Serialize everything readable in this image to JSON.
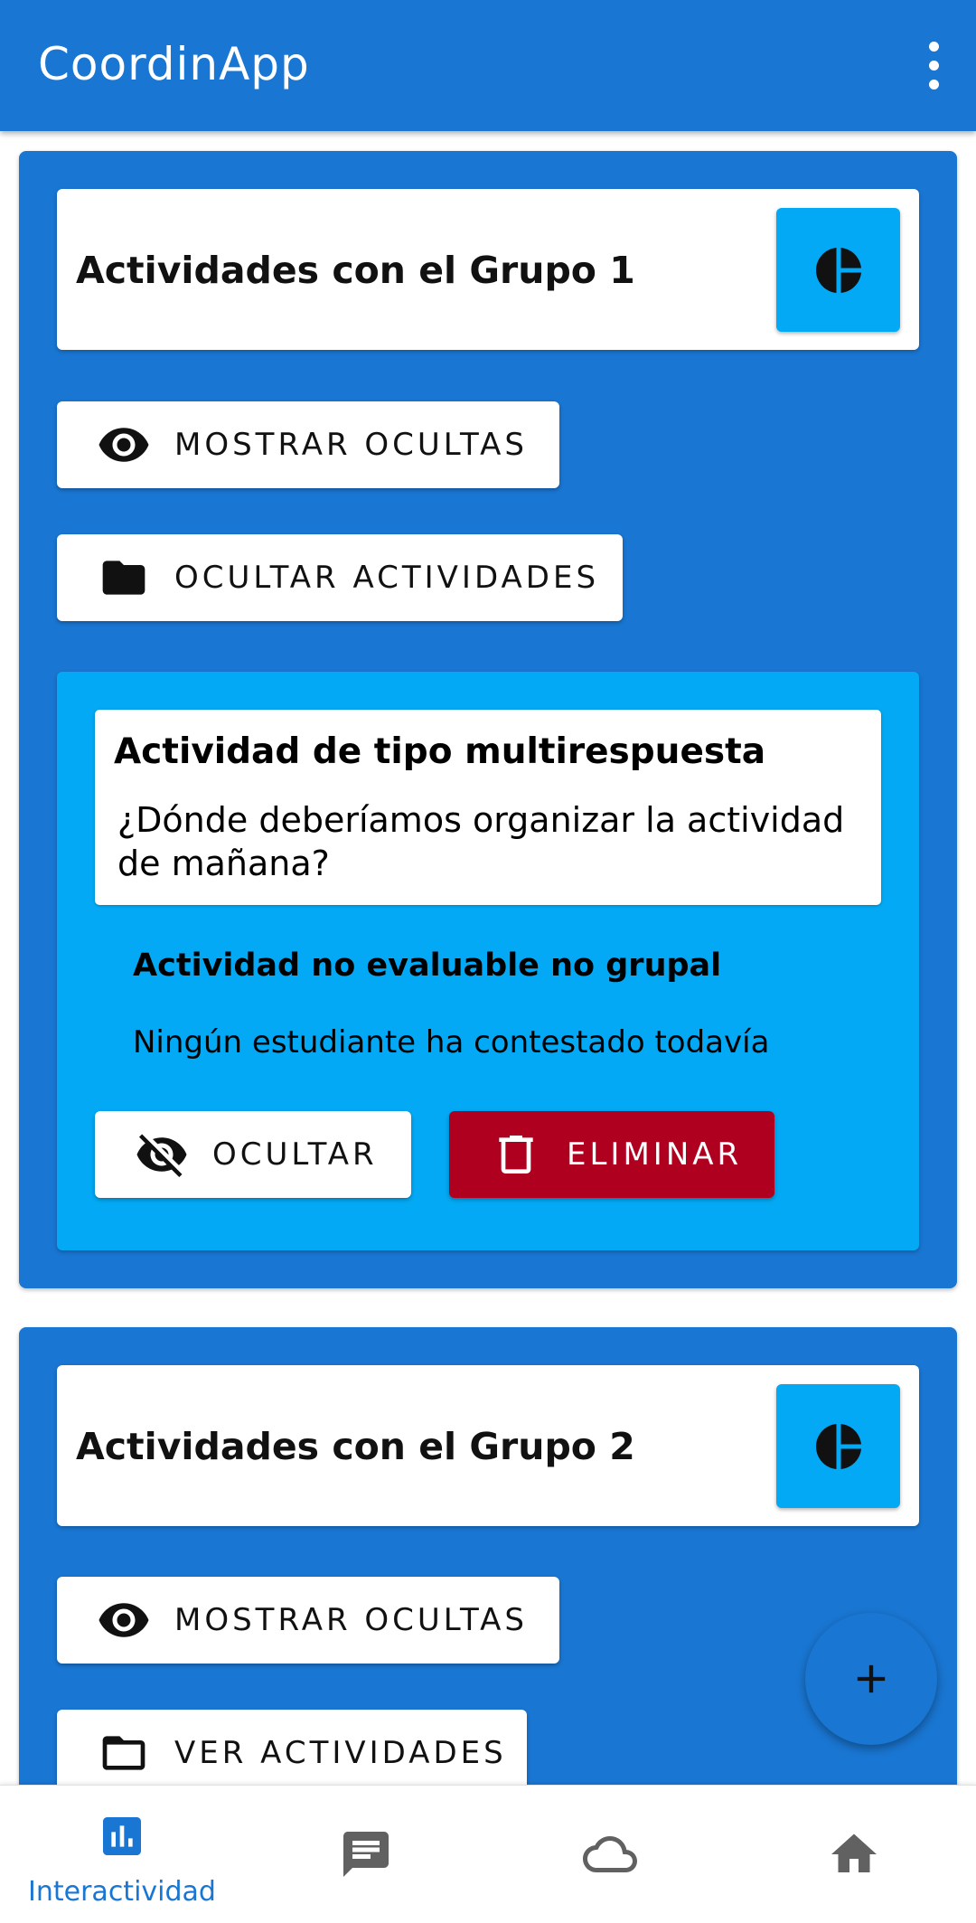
{
  "appbar": {
    "title": "CoordinApp",
    "menu_icon": "more-vert-icon"
  },
  "groups": [
    {
      "title": "Actividades con el Grupo 1",
      "show_hidden_label": "MOSTRAR OCULTAS",
      "folder_label": "OCULTAR ACTIVIDADES",
      "activity": {
        "type": "Actividad de tipo multirespuesta",
        "question": "¿Dónde deberíamos organizar la actividad de mañana?",
        "evaluation": "Actividad no evaluable no grupal",
        "status": "Ningún estudiante ha contestado todavía",
        "hide_label": "OCULTAR",
        "delete_label": "ELIMINAR"
      }
    },
    {
      "title": "Actividades con el Grupo 2",
      "show_hidden_label": "MOSTRAR OCULTAS",
      "folder_label": "VER ACTIVIDADES"
    }
  ],
  "fab": {
    "icon": "add-icon"
  },
  "bottom_nav": [
    {
      "label": "Interactividad",
      "icon": "bar-chart-icon",
      "active": true
    },
    {
      "label": "",
      "icon": "chat-icon",
      "active": false
    },
    {
      "label": "",
      "icon": "cloud-icon",
      "active": false
    },
    {
      "label": "",
      "icon": "home-icon",
      "active": false
    }
  ],
  "colors": {
    "primary": "#1976d2",
    "accent": "#03a9f4",
    "danger": "#b00020",
    "nav_inactive": "#616161"
  }
}
